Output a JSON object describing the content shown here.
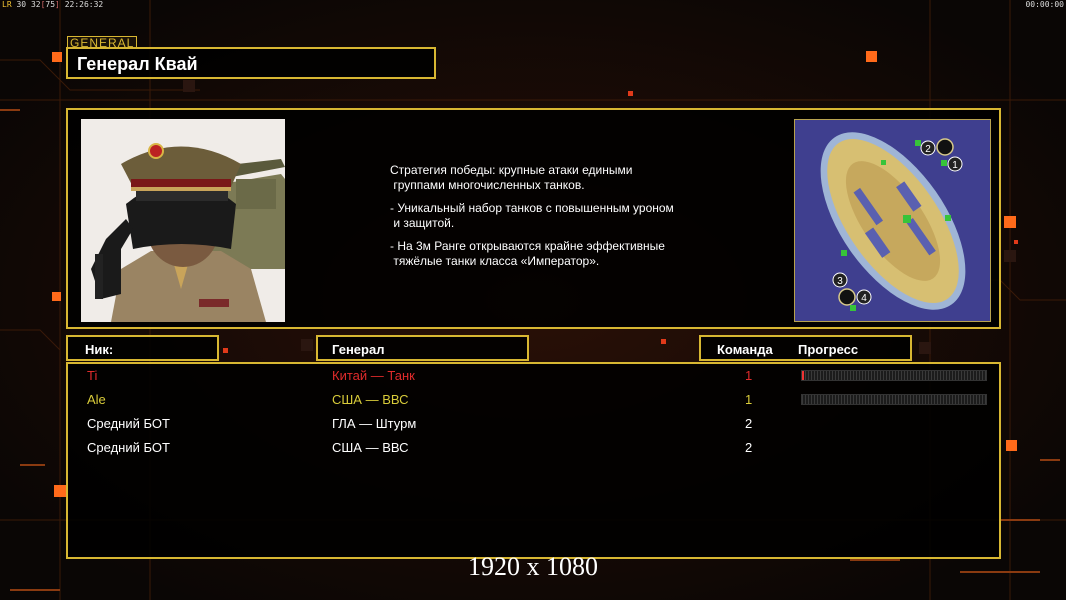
{
  "hud": {
    "lr_label": "LR",
    "stat_a": "30",
    "stat_b": "32",
    "fps": "75",
    "clock": "22:26:32",
    "timer": "00:00:00"
  },
  "general_tag": "GENERAL",
  "general_name": "Генерал Квай",
  "description": [
    "Стратегия победы: крупные атаки едиными\n группами многочисленных танков.",
    "- Уникальный набор танков с повышенным уроном\n и защитой.",
    "- На 3м Ранге открываются крайне эффективные\n тяжёлые танки класса «Император»."
  ],
  "minimap": {
    "start_positions": [
      "1",
      "2",
      "3",
      "4"
    ]
  },
  "table": {
    "headers": {
      "nick": "Ник:",
      "general": "Генерал",
      "team": "Команда",
      "progress": "Прогресс"
    },
    "rows": [
      {
        "nick": "Ti",
        "general": "Китай — Танк",
        "team": "1",
        "color": "#e02b2b",
        "progress": 0.01,
        "has_progress": true
      },
      {
        "nick": "Ale",
        "general": "США — ВВС",
        "team": "1",
        "color": "#d9cc3a",
        "progress": 0.0,
        "has_progress": true
      },
      {
        "nick": "Средний БОТ",
        "general": "ГЛА — Штурм",
        "team": "2",
        "color": "#ffffff",
        "progress": 0.0,
        "has_progress": false
      },
      {
        "nick": "Средний БОТ",
        "general": "США — ВВС",
        "team": "2",
        "color": "#ffffff",
        "progress": 0.0,
        "has_progress": false
      }
    ]
  },
  "resolution_label": "1920 x 1080",
  "colors": {
    "gold": "#d8b732",
    "accent_orange": "#ff6a1a"
  }
}
